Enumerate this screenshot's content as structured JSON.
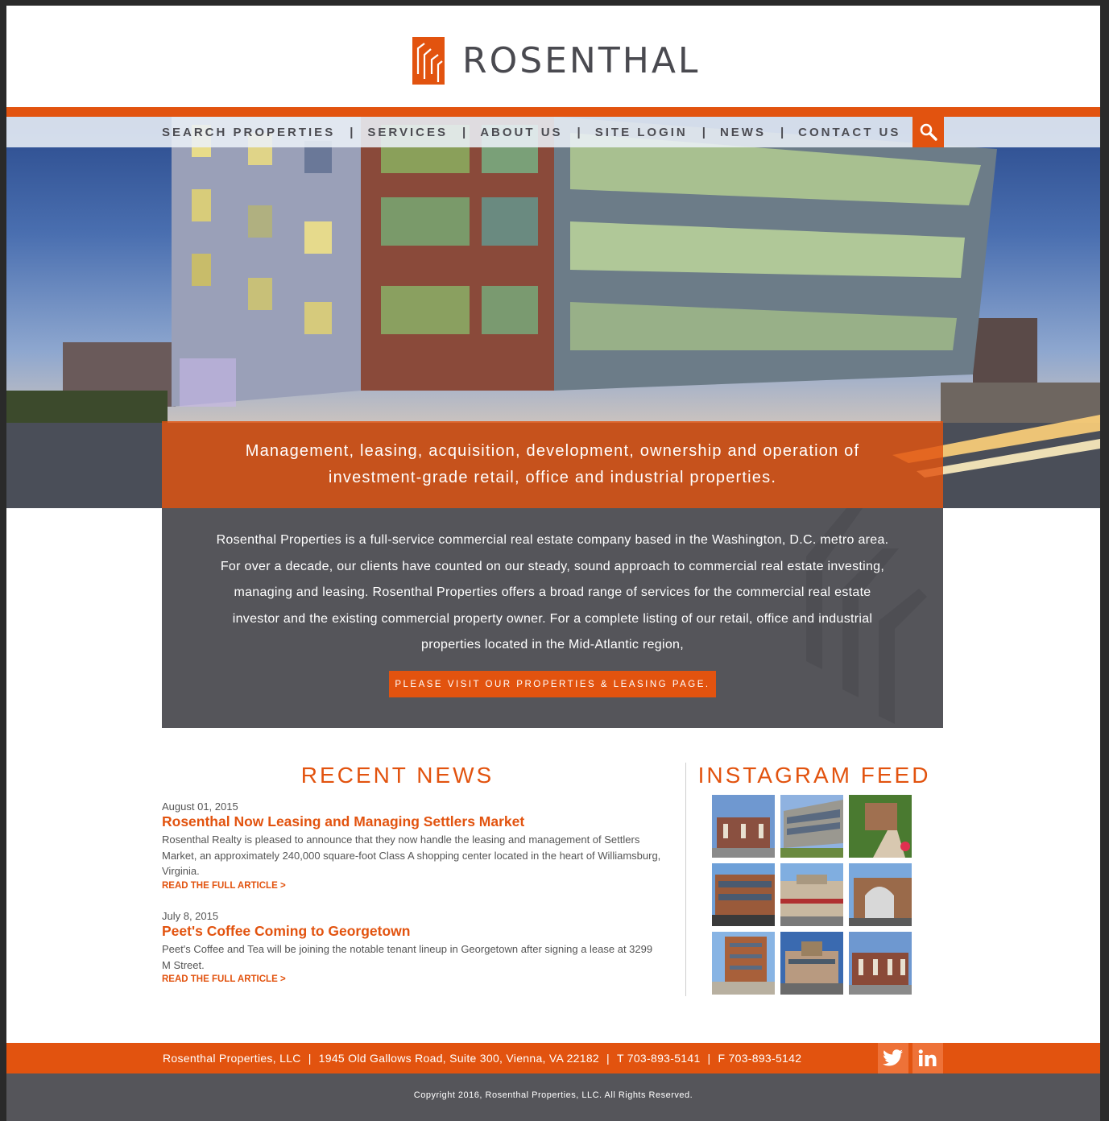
{
  "brand": {
    "name": "ROSENTHAL",
    "accent": "#e2530f",
    "dark": "#55555a"
  },
  "nav": {
    "items": [
      "SEARCH PROPERTIES",
      "SERVICES",
      "ABOUT US",
      "SITE LOGIN",
      "NEWS",
      "CONTACT US"
    ],
    "separator": "|",
    "search_icon": "search-icon"
  },
  "hero": {
    "tagline_line1": "Management, leasing, acquisition, development, ownership and operation of",
    "tagline_line2": "investment-grade retail, office and industrial properties."
  },
  "intro": {
    "text": "Rosenthal Properties is a full-service commercial real estate company based in the Washington, D.C. metro area. For over a decade, our clients have counted on our steady, sound approach to commercial real estate investing, managing and leasing. Rosenthal Properties offers a broad range of services for the commercial real estate investor and the existing commercial property owner. For a complete listing of our retail, office and industrial properties located in the Mid-Atlantic region,",
    "button": "PLEASE VISIT OUR PROPERTIES & LEASING PAGE."
  },
  "news": {
    "title": "RECENT NEWS",
    "items": [
      {
        "date": "August 01, 2015",
        "headline": "Rosenthal Now Leasing and Managing Settlers Market",
        "body": "Rosenthal Realty is pleased to announce that they now handle the leasing and management of Settlers Market, an approximately 240,000 square-foot Class A shopping center located in the heart of Williamsburg, Virginia.",
        "link": "READ THE FULL ARTICLE >"
      },
      {
        "date": "July 8, 2015",
        "headline": "Peet's Coffee Coming to Georgetown",
        "body": "Peet's Coffee and Tea will be joining the notable tenant lineup in Georgetown after signing a lease at 3299 M Street.",
        "link": "READ THE FULL ARTICLE >"
      }
    ]
  },
  "instagram": {
    "title": "INSTAGRAM FEED"
  },
  "footer": {
    "company": "Rosenthal Properties, LLC",
    "address": "1945 Old Gallows Road, Suite 300, Vienna, VA 22182",
    "phone": "T 703-893-5141",
    "fax": "F 703-893-5142",
    "separator": "|",
    "social": [
      "twitter-icon",
      "linkedin-icon"
    ],
    "copyright": "Copyright 2016, Rosenthal Properties, LLC. All Rights Reserved."
  }
}
